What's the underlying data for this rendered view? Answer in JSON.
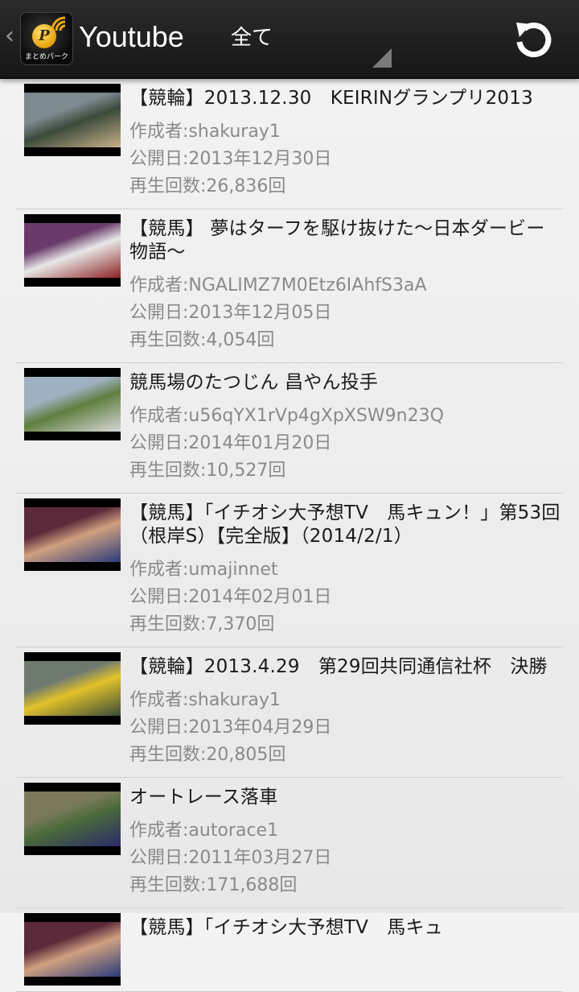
{
  "header": {
    "back_icon": "chevron-left-icon",
    "app_icon": "matome-park-logo",
    "app_icon_letter": "P",
    "app_icon_caption": "まとめパーク",
    "title": "Youtube",
    "filter_value": "全て",
    "refresh_icon": "refresh-icon"
  },
  "videos": [
    {
      "title": "【競輪】2013.12.30　KEIRINグランプリ2013",
      "author": "作成者:shakuray1",
      "published": "公開日:2013年12月30日",
      "views": "再生回数:26,836回",
      "thumb_colors": [
        "#7d8a8f",
        "#3b4a3a",
        "#c9b28a"
      ]
    },
    {
      "title": "【競馬】 夢はターフを駆け抜けた～日本ダービー物語～",
      "author": "作成者:NGALIMZ7M0Etz6IAhfS3aA",
      "published": "公開日:2013年12月05日",
      "views": "再生回数:4,054回",
      "thumb_colors": [
        "#6a3b6a",
        "#e8e8e8",
        "#8c2020"
      ]
    },
    {
      "title": "競馬場のたつじん 昌やん投手",
      "author": "作成者:u56qYX1rVp4gXpXSW9n23Q",
      "published": "公開日:2014年01月20日",
      "views": "再生回数:10,527回",
      "thumb_colors": [
        "#9fb0c0",
        "#5f7f3f",
        "#d8d8d8"
      ]
    },
    {
      "title": "【競馬】「イチオシ大予想TV　馬キュン！」第53回（根岸S）【完全版】（2014/2/1）",
      "author": "作成者:umajinnet",
      "published": "公開日:2014年02月01日",
      "views": "再生回数:7,370回",
      "thumb_colors": [
        "#5a2a3a",
        "#d0a080",
        "#2a3a7a"
      ]
    },
    {
      "title": "【競輪】2013.4.29　第29回共同通信社杯　決勝",
      "author": "作成者:shakuray1",
      "published": "公開日:2013年04月29日",
      "views": "再生回数:20,805回",
      "thumb_colors": [
        "#6e7a70",
        "#e2c22a",
        "#3a4a3a"
      ]
    },
    {
      "title": "オートレース落車",
      "author": "作成者:autorace1",
      "published": "公開日:2011年03月27日",
      "views": "再生回数:171,688回",
      "thumb_colors": [
        "#7a7a5a",
        "#4a6a3a",
        "#2a2a6a"
      ]
    },
    {
      "title": "【競馬】「イチオシ大予想TV　馬キュ",
      "author": "",
      "published": "",
      "views": "",
      "thumb_colors": [
        "#5a2a3a",
        "#d0a080",
        "#2a3a7a"
      ]
    }
  ]
}
